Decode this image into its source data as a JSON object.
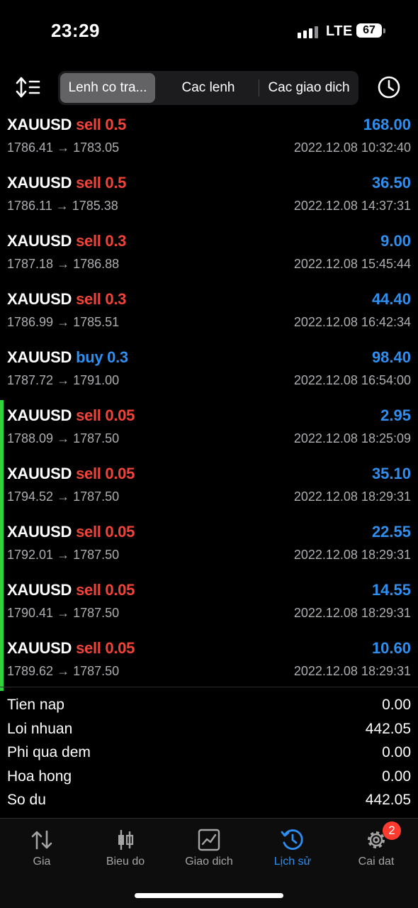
{
  "status_bar": {
    "time": "23:29",
    "network": "LTE",
    "battery": "67"
  },
  "toolbar": {
    "tabs": [
      "Lenh co tra...",
      "Cac lenh",
      "Cac giao dich"
    ],
    "active_tab": 0
  },
  "trades": [
    {
      "symbol": "XAUUSD",
      "type": "sell",
      "volume": "0.5",
      "open": "1786.41",
      "close": "1783.05",
      "profit": "168.00",
      "time": "2022.12.08 10:32:40"
    },
    {
      "symbol": "XAUUSD",
      "type": "sell",
      "volume": "0.5",
      "open": "1786.11",
      "close": "1785.38",
      "profit": "36.50",
      "time": "2022.12.08 14:37:31"
    },
    {
      "symbol": "XAUUSD",
      "type": "sell",
      "volume": "0.3",
      "open": "1787.18",
      "close": "1786.88",
      "profit": "9.00",
      "time": "2022.12.08 15:45:44"
    },
    {
      "symbol": "XAUUSD",
      "type": "sell",
      "volume": "0.3",
      "open": "1786.99",
      "close": "1785.51",
      "profit": "44.40",
      "time": "2022.12.08 16:42:34"
    },
    {
      "symbol": "XAUUSD",
      "type": "buy",
      "volume": "0.3",
      "open": "1787.72",
      "close": "1791.00",
      "profit": "98.40",
      "time": "2022.12.08 16:54:00"
    },
    {
      "symbol": "XAUUSD",
      "type": "sell",
      "volume": "0.05",
      "open": "1788.09",
      "close": "1787.50",
      "profit": "2.95",
      "time": "2022.12.08 18:25:09"
    },
    {
      "symbol": "XAUUSD",
      "type": "sell",
      "volume": "0.05",
      "open": "1794.52",
      "close": "1787.50",
      "profit": "35.10",
      "time": "2022.12.08 18:29:31"
    },
    {
      "symbol": "XAUUSD",
      "type": "sell",
      "volume": "0.05",
      "open": "1792.01",
      "close": "1787.50",
      "profit": "22.55",
      "time": "2022.12.08 18:29:31"
    },
    {
      "symbol": "XAUUSD",
      "type": "sell",
      "volume": "0.05",
      "open": "1790.41",
      "close": "1787.50",
      "profit": "14.55",
      "time": "2022.12.08 18:29:31"
    },
    {
      "symbol": "XAUUSD",
      "type": "sell",
      "volume": "0.05",
      "open": "1789.62",
      "close": "1787.50",
      "profit": "10.60",
      "time": "2022.12.08 18:29:31"
    }
  ],
  "summary": [
    {
      "label": "Tien nap",
      "value": "0.00"
    },
    {
      "label": "Loi nhuan",
      "value": "442.05"
    },
    {
      "label": "Phi qua dem",
      "value": "0.00"
    },
    {
      "label": "Hoa hong",
      "value": "0.00"
    },
    {
      "label": "So du",
      "value": "442.05"
    }
  ],
  "tabbar": {
    "items": [
      {
        "label": "Gia",
        "icon": "quotes-arrows-icon"
      },
      {
        "label": "Bieu do",
        "icon": "candlestick-chart-icon"
      },
      {
        "label": "Giao dich",
        "icon": "trade-chart-icon"
      },
      {
        "label": "Lịch sử",
        "icon": "history-clock-icon"
      },
      {
        "label": "Cai dat",
        "icon": "settings-gear-icon"
      }
    ],
    "active": 3,
    "settings_badge": "2"
  },
  "colors": {
    "sell": "#f0443a",
    "buy": "#2f8ff0",
    "profit": "#2f8ff0",
    "marker": "#2fd33d",
    "active_tab": "#2f8ff0"
  }
}
